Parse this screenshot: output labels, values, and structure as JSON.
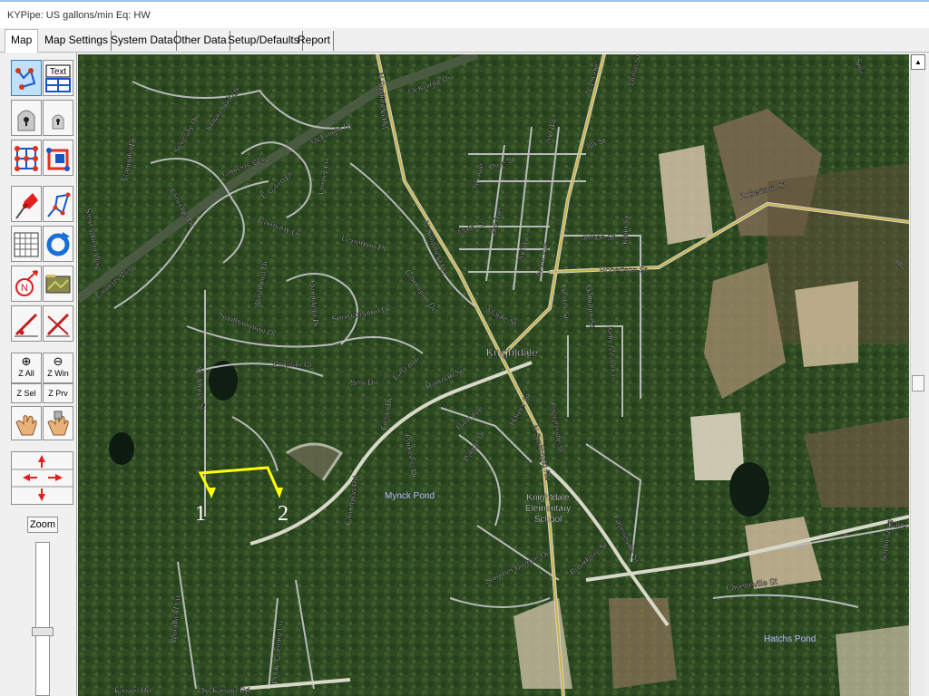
{
  "window": {
    "title": "KYPipe: US gallons/min  Eq: HW"
  },
  "tabs": [
    {
      "label": "Map",
      "active": true
    },
    {
      "label": "Map Settings"
    },
    {
      "label": "System Data"
    },
    {
      "label": "Other Data"
    },
    {
      "label": "Setup/Defaults"
    },
    {
      "label": "Report"
    }
  ],
  "toolbar": {
    "tools": [
      {
        "name": "select-nodes-tool",
        "icon": "node-select-icon",
        "pressed": true
      },
      {
        "name": "text-tool",
        "label": "Text",
        "icon": "text-box-icon"
      },
      {
        "name": "lock-tool",
        "icon": "lock-icon"
      },
      {
        "name": "lock-small-tool",
        "icon": "lock-small-icon"
      },
      {
        "name": "network-tool",
        "icon": "network-icon"
      },
      {
        "name": "network-junction-tool",
        "icon": "network-junction-icon"
      },
      {
        "name": "pushpin-tool",
        "icon": "pushpin-icon"
      },
      {
        "name": "node-pipe-tool",
        "icon": "node-pipe-icon"
      },
      {
        "name": "table-tool",
        "icon": "grid-table-icon"
      },
      {
        "name": "refresh-tool",
        "icon": "refresh-icon"
      },
      {
        "name": "north-arrow-tool",
        "icon": "north-arrow-icon"
      },
      {
        "name": "background-image-tool",
        "icon": "map-image-icon"
      },
      {
        "name": "draw-pipe-tool",
        "icon": "pencil-line-icon"
      },
      {
        "name": "delete-pipe-tool",
        "icon": "pencil-cross-icon"
      }
    ],
    "zoom_buttons": [
      {
        "label": "Z All",
        "glyph": "⊕"
      },
      {
        "label": "Z Win",
        "glyph": "⊖"
      },
      {
        "label": "Z Sel",
        "glyph": ""
      },
      {
        "label": "Z Prv",
        "glyph": ""
      }
    ],
    "pan_tools": [
      {
        "name": "pan-hand-tool",
        "icon": "hand-icon"
      },
      {
        "name": "pan-lock-tool",
        "icon": "hand-lock-icon"
      }
    ],
    "zoom_label": "Zoom",
    "zoom_level": 0.55
  },
  "map": {
    "street_labels": [
      "McKnight Dr",
      "McKnight Dr",
      "N Smithfield Rd",
      "N Smithfield Rd",
      "N 1st Ave",
      "Griffin St",
      "2nd Ave",
      "4th St",
      "Pine St",
      "4th Ave",
      "Main St",
      "3rd Ave",
      "2nd Ave",
      "N 1st Ave",
      "Julson St",
      "Keith St",
      "Robertson St",
      "Robertson St",
      "Ro",
      "Stanway Dr",
      "Laurens Way",
      "Laurens Way",
      "E Carro Dr",
      "Carmany Ln",
      "Luxury Ln",
      "Elmridge Dr",
      "Indian Springs",
      "Magnolia Dr",
      "Stein Wheel Way",
      "Lexington Pl",
      "Carrington Dr",
      "Washburn Dr",
      "Brookfield Dr",
      "Southampton Dr",
      "Southampton Dr",
      "Plowlan Ct",
      "Sills Dr",
      "East Ave",
      "Railroad St",
      "Maple St",
      "Hester St",
      "Gallinger St",
      "Kelly Meadows",
      "St John's St",
      "Fiesta Dr",
      "Park Ave",
      "Parkview Dr",
      "Farrington Rd",
      "Pabon Dr",
      "Harper St",
      "N Smithfield Rd",
      "Fayetteville St",
      "Broadway St",
      "Fayetteville St",
      "Fayetteville St",
      "Summer Breeze Dr",
      "Woodfield Ln",
      "Poole Country Ln",
      "Old Faison Rd",
      "Faison Rd",
      "Faye",
      "Sawdust Ln",
      "Split"
    ],
    "place_labels": [
      "Knightdale",
      "Mynck Pond",
      "Knightdale\nElementary\nSchool",
      "Hatchs Pond"
    ],
    "pipe_node_labels": [
      "1",
      "2"
    ],
    "pipe_color": "#ffff00"
  },
  "scrollbar": {
    "up_arrow": "▲",
    "position": 0.5
  }
}
